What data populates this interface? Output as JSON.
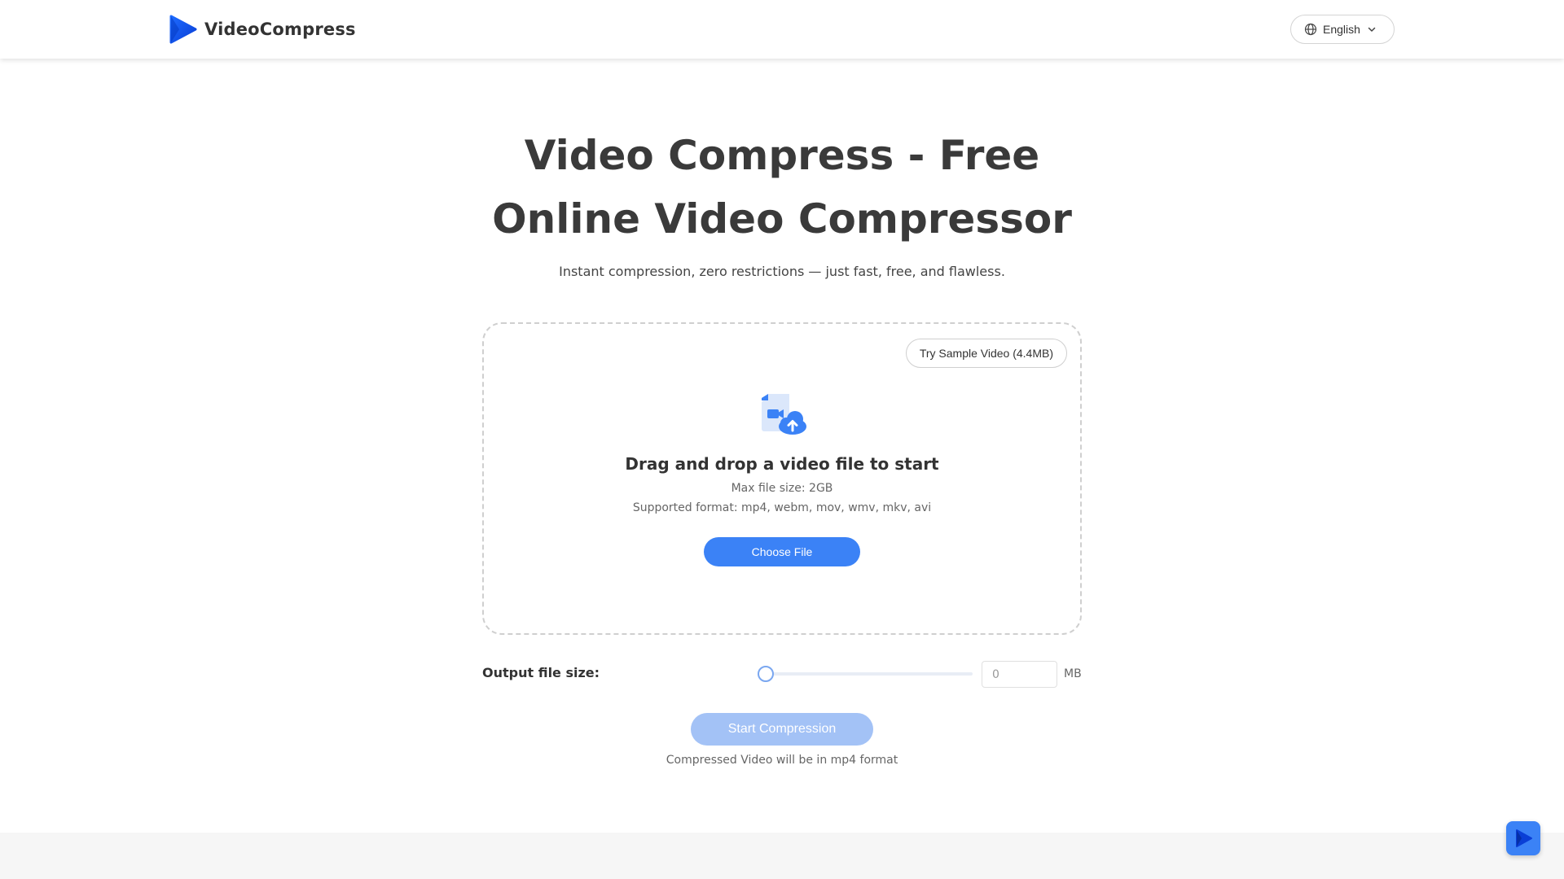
{
  "header": {
    "brand_name": "VideoCompress",
    "brand_icon": "play-logo-icon",
    "language": "English",
    "language_icon": "globe-icon",
    "language_chevron": "chevron-down-icon"
  },
  "hero": {
    "title_line1": "Video Compress - Free",
    "title_line2": "Online Video Compressor",
    "subtitle": "Instant compression, zero restrictions — just fast, free, and flawless."
  },
  "dropzone": {
    "sample_button": "Try Sample Video (4.4MB)",
    "icon": "video-upload-cloud-icon",
    "heading": "Drag and drop a video file to start",
    "max_size": "Max file size: 2GB",
    "formats": "Supported format: mp4, webm, mov, wmv, mkv, avi",
    "choose_button": "Choose File"
  },
  "output": {
    "label": "Output file size:",
    "slider_value_fraction": 0,
    "input_value": "0",
    "unit": "MB"
  },
  "actions": {
    "start_button": "Start Compression",
    "start_disabled": true,
    "note": "Compressed Video will be in mp4 format"
  },
  "fab": {
    "icon": "play-logo-icon"
  },
  "colors": {
    "accent": "#3b82f6",
    "accent_disabled": "#a3c2f6",
    "title": "#3a3a3a"
  }
}
